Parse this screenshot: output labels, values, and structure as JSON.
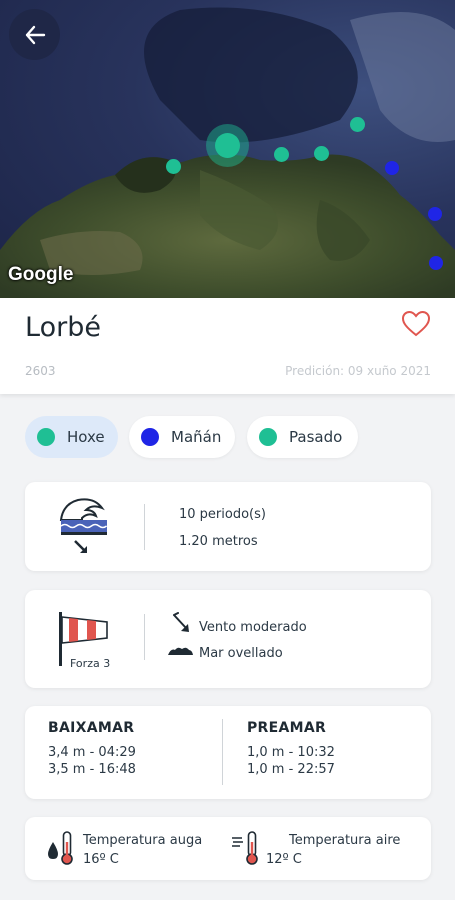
{
  "map": {
    "attribution": "Google",
    "selected_color": "#1fbf94",
    "marker_green": "#1fbf94",
    "marker_blue": "#1f25e6"
  },
  "header": {
    "title": "Lorbé",
    "code": "2603",
    "prediction": "Predición: 09 xuño 2021",
    "heart_color": "#e0564f"
  },
  "days": [
    {
      "label": "Hoxe",
      "color": "#1fbf94",
      "active": true
    },
    {
      "label": "Mañán",
      "color": "#1f25e6",
      "active": false
    },
    {
      "label": "Pasado",
      "color": "#1fbf94",
      "active": false
    }
  ],
  "waves": {
    "period": "10 periodo(s)",
    "height": "1.20 metros"
  },
  "wind": {
    "force": "Forza 3",
    "wind_text": "Vento moderado",
    "sea_text": "Mar ovellado"
  },
  "tides": {
    "low": {
      "title": "BAIXAMAR",
      "rows": [
        "3,4 m - 04:29",
        "3,5 m - 16:48"
      ]
    },
    "high": {
      "title": "PREAMAR",
      "rows": [
        "1,0 m - 10:32",
        "1,0 m - 22:57"
      ]
    }
  },
  "temps": {
    "water": {
      "label": "Temperatura auga",
      "value": "16º C"
    },
    "air": {
      "label": "Temperatura aire",
      "value": "12º C"
    }
  }
}
